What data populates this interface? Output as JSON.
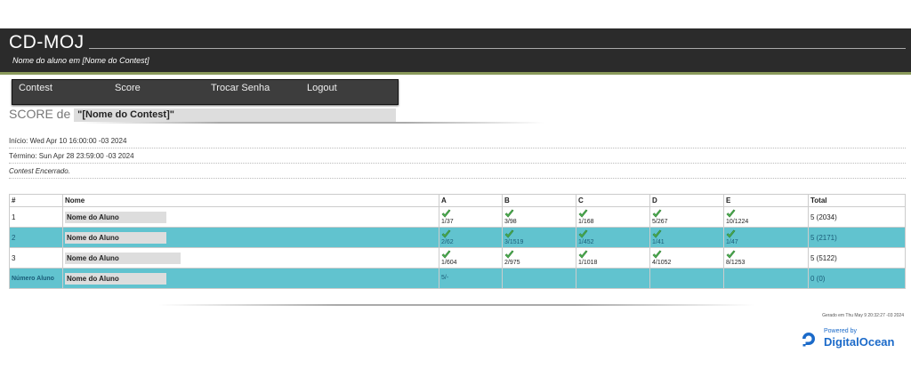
{
  "header": {
    "title": "CD-MOJ",
    "subtitle": "Nome do aluno em [Nome do Contest]"
  },
  "nav": {
    "items": [
      {
        "label": "Contest"
      },
      {
        "label": "Score"
      },
      {
        "label": "Trocar Senha"
      },
      {
        "label": "Logout"
      }
    ]
  },
  "score": {
    "title_prefix": "SCORE de",
    "contest_name": "\"[Nome do Contest]\""
  },
  "info": {
    "inicio": "Início: Wed Apr 10 16:00:00 -03 2024",
    "termino": "Término: Sun Apr 28 23:59:00 -03 2024",
    "status": "Contest Encerrado."
  },
  "table": {
    "headers": [
      "#",
      "Nome",
      "A",
      "B",
      "C",
      "D",
      "E",
      "Total"
    ],
    "rows": [
      {
        "rank": "1",
        "name": "Nome do Aluno",
        "problems": [
          "1/37",
          "3/98",
          "1/168",
          "5/267",
          "10/1224"
        ],
        "total": "5 (2034)"
      },
      {
        "rank": "2",
        "name": "Nome do Aluno",
        "problems": [
          "2/62",
          "3/1519",
          "1/452",
          "1/41",
          "1/47"
        ],
        "total": "5 (2171)"
      },
      {
        "rank": "3",
        "name": "Nome do Aluno",
        "problems": [
          "1/604",
          "2/975",
          "1/1018",
          "4/1052",
          "8/1253"
        ],
        "total": "5 (5122)"
      },
      {
        "rank": "Número Aluno",
        "name": "Nome do Aluno",
        "problems": [
          "5/-",
          "",
          "",
          "",
          ""
        ],
        "total": "0 (0)"
      }
    ]
  },
  "footer": {
    "generated": "Gerado em Thu May 9 20:32:27 -03 2024",
    "powered_by": "Powered by",
    "brand": "DigitalOcean"
  },
  "colors": {
    "header_bg": "#2b2b2b",
    "highlight_row": "#61c3cf",
    "check_green": "#4caf50",
    "brand_blue": "#1b6ac9"
  }
}
